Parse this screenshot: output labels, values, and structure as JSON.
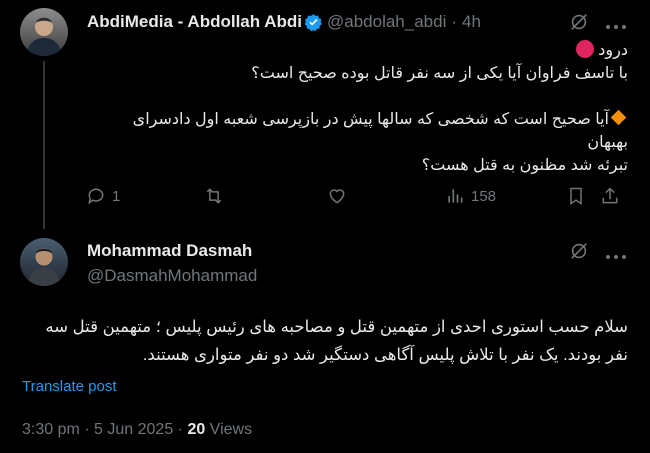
{
  "reply_tweet": {
    "display_name": "AbdiMedia - Abdollah Abdi",
    "handle": "@abdolah_abdi",
    "separator": "·",
    "time": "4h",
    "lines": [
      "درود",
      "با تاسف فراوان آیا یکی از سه نفر قاتل بوده صحیح است؟",
      "آیا صحیح است که شخصی که سالها پیش در بازپرسی شعبه اول دادسرای بهبهان",
      "تبرئه شد مظنون به قتل هست؟"
    ],
    "actions": {
      "reply_count": "1",
      "retweet_count": "",
      "like_count": "",
      "views_count": "158"
    }
  },
  "main_tweet": {
    "display_name": "Mohammad Dasmah",
    "handle": "@DasmahMohammad",
    "lines": [
      "سلام حسب استوری احدی از متهمین قتل و مصاحبه های رئیس پلیس ؛ متهمین قتل سه",
      "نفر بودند. یک نفر با تلاش پلیس آگاهی دستگیر شد دو نفر متواری هستند."
    ],
    "translate_label": "Translate post",
    "timestamp": "3:30 pm · 5 Jun 2025 · ",
    "views_count": "20",
    "views_label": " Views"
  },
  "colors": {
    "background": "#000000",
    "text": "#e7e9ea",
    "muted": "#71767b",
    "accent": "#1d9bf0"
  }
}
